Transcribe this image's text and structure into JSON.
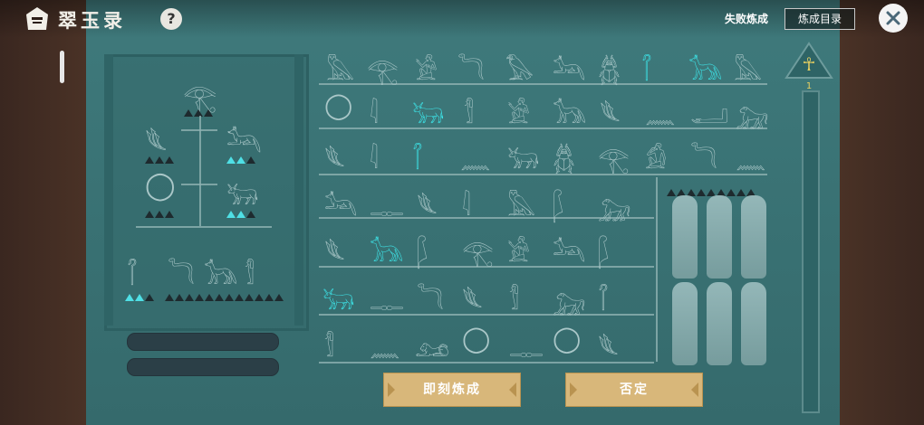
{
  "header": {
    "title": "翠玉录",
    "help_icon": "question-mark-icon",
    "fail_label": "失败炼成",
    "catalog_button": "炼成目录",
    "close_icon": "close-x-icon"
  },
  "ankh": {
    "level": "1"
  },
  "actions": {
    "confirm_label": "即刻炼成",
    "deny_label": "否定"
  },
  "colors": {
    "board": "#3a7375",
    "highlight": "#3de6ea",
    "button": "#d8b77a"
  },
  "glyph_grid": {
    "row1": [
      "bird-glyph",
      "eye-glyph",
      "seated-figure-glyph",
      "snake-glyph",
      "bird-glyph",
      "jackal-glyph",
      "scarab-glyph",
      "crook-flail-glyph",
      "jackal-head-glyph",
      "bird-glyph"
    ],
    "row2": [
      "ring-glyph",
      "reed-glyph",
      "bull-glyph",
      "mummy-glyph",
      "seated-figure-glyph",
      "jackal-head-glyph",
      "reeds-glyph",
      "water-glyph",
      "hand-glyph",
      "baboon-glyph"
    ],
    "row3": [
      "reeds-glyph",
      "reed-glyph",
      "crook-flail-glyph",
      "water-glyph",
      "bull-glyph",
      "scarab-glyph",
      "eye-glyph",
      "figure-glyph",
      "snake-glyph",
      "water-glyph"
    ],
    "row4": [
      "jackal-glyph",
      "sign-glyph",
      "reeds-glyph",
      "reed-glyph",
      "bird-glyph",
      "feather-glyph",
      "baboon-glyph"
    ],
    "row5": [
      "reeds-glyph",
      "jackal-head-glyph",
      "feather-glyph",
      "eye-glyph",
      "seated-figure-glyph",
      "jackal-glyph",
      "feather-glyph"
    ],
    "row6": [
      "bull-glyph",
      "sign-glyph",
      "snake-glyph",
      "reeds-glyph",
      "mummy-glyph",
      "baboon-glyph",
      "crook-flail-glyph"
    ],
    "row7": [
      "mummy-glyph",
      "water-glyph",
      "lion-glyph",
      "ring-glyph",
      "sign-glyph",
      "ring-glyph",
      "reeds-glyph"
    ]
  }
}
